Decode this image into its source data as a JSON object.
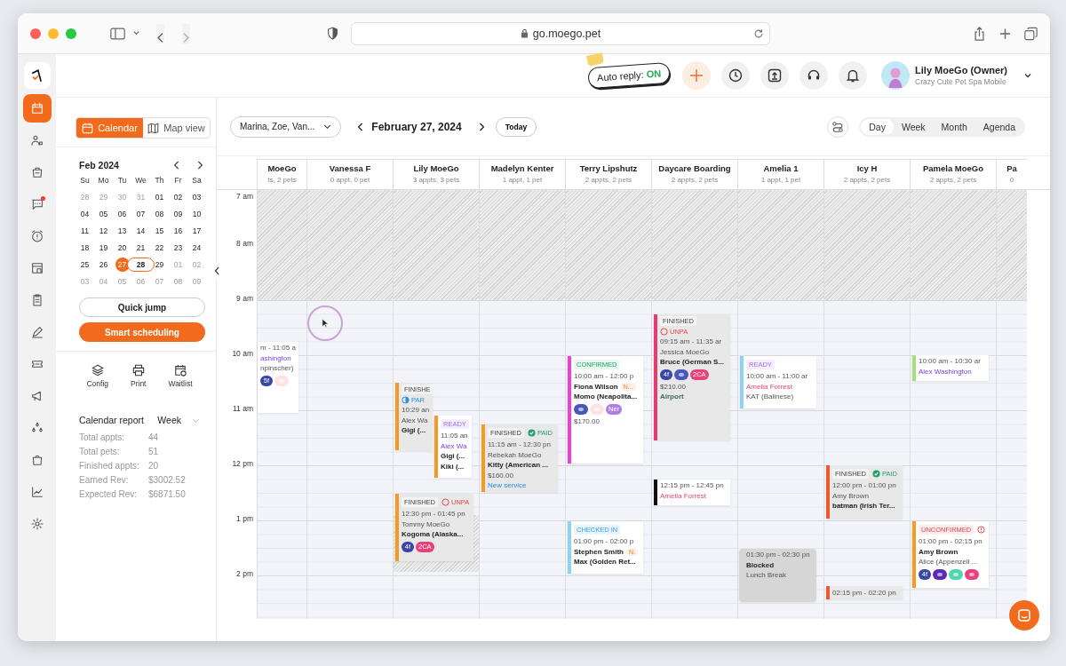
{
  "browser": {
    "url": "go.moego.pet"
  },
  "nav": [
    {
      "selected": true,
      "badge": false
    },
    {
      "selected": false,
      "badge": false
    },
    {
      "selected": false,
      "badge": false
    },
    {
      "selected": false,
      "badge": true
    },
    {
      "selected": false,
      "badge": false
    },
    {
      "selected": false,
      "badge": false
    },
    {
      "selected": false,
      "badge": false
    },
    {
      "selected": false,
      "badge": false
    },
    {
      "selected": false,
      "badge": false
    },
    {
      "selected": false,
      "badge": false
    },
    {
      "selected": false,
      "badge": false
    },
    {
      "selected": false,
      "badge": false
    },
    {
      "selected": false,
      "badge": false
    },
    {
      "selected": false,
      "badge": false
    }
  ],
  "header": {
    "auto_reply": {
      "label": "Auto reply:",
      "value": "ON"
    },
    "user": {
      "name": "Lily MoeGo (Owner)",
      "business": "Crazy Cute Pet Spa Mobile"
    }
  },
  "view_toggle": [
    {
      "label": "Calendar",
      "selected": true
    },
    {
      "label": "Map view",
      "selected": false
    }
  ],
  "mini_calendar": {
    "title": "Feb 2024",
    "weekdays": [
      "Su",
      "Mo",
      "Tu",
      "We",
      "Th",
      "Fr",
      "Sa"
    ],
    "weeks": [
      [
        {
          "day": "28",
          "muted": true,
          "selected": false,
          "today": false
        },
        {
          "day": "29",
          "muted": true,
          "selected": false,
          "today": false
        },
        {
          "day": "30",
          "muted": true,
          "selected": false,
          "today": false
        },
        {
          "day": "31",
          "muted": true,
          "selected": false,
          "today": false
        },
        {
          "day": "01",
          "muted": false,
          "selected": false,
          "today": false
        },
        {
          "day": "02",
          "muted": false,
          "selected": false,
          "today": false
        },
        {
          "day": "03",
          "muted": false,
          "selected": false,
          "today": false
        }
      ],
      [
        {
          "day": "04",
          "muted": false,
          "selected": false,
          "today": false
        },
        {
          "day": "05",
          "muted": false,
          "selected": false,
          "today": false
        },
        {
          "day": "06",
          "muted": false,
          "selected": false,
          "today": false
        },
        {
          "day": "07",
          "muted": false,
          "selected": false,
          "today": false
        },
        {
          "day": "08",
          "muted": false,
          "selected": false,
          "today": false
        },
        {
          "day": "09",
          "muted": false,
          "selected": false,
          "today": false
        },
        {
          "day": "10",
          "muted": false,
          "selected": false,
          "today": false
        }
      ],
      [
        {
          "day": "11",
          "muted": false,
          "selected": false,
          "today": false
        },
        {
          "day": "12",
          "muted": false,
          "selected": false,
          "today": false
        },
        {
          "day": "13",
          "muted": false,
          "selected": false,
          "today": false
        },
        {
          "day": "14",
          "muted": false,
          "selected": false,
          "today": false
        },
        {
          "day": "15",
          "muted": false,
          "selected": false,
          "today": false
        },
        {
          "day": "16",
          "muted": false,
          "selected": false,
          "today": false
        },
        {
          "day": "17",
          "muted": false,
          "selected": false,
          "today": false
        }
      ],
      [
        {
          "day": "18",
          "muted": false,
          "selected": false,
          "today": false
        },
        {
          "day": "19",
          "muted": false,
          "selected": false,
          "today": false
        },
        {
          "day": "20",
          "muted": false,
          "selected": false,
          "today": false
        },
        {
          "day": "21",
          "muted": false,
          "selected": false,
          "today": false
        },
        {
          "day": "22",
          "muted": false,
          "selected": false,
          "today": false
        },
        {
          "day": "23",
          "muted": false,
          "selected": false,
          "today": false
        },
        {
          "day": "24",
          "muted": false,
          "selected": false,
          "today": false
        }
      ],
      [
        {
          "day": "25",
          "muted": false,
          "selected": false,
          "today": false
        },
        {
          "day": "26",
          "muted": false,
          "selected": false,
          "today": false
        },
        {
          "day": "27",
          "muted": false,
          "selected": true,
          "today": false
        },
        {
          "day": "28",
          "muted": false,
          "selected": false,
          "today": true
        },
        {
          "day": "29",
          "muted": false,
          "selected": false,
          "today": false
        },
        {
          "day": "01",
          "muted": true,
          "selected": false,
          "today": false
        },
        {
          "day": "02",
          "muted": true,
          "selected": false,
          "today": false
        }
      ],
      [
        {
          "day": "03",
          "muted": true,
          "selected": false,
          "today": false
        },
        {
          "day": "04",
          "muted": true,
          "selected": false,
          "today": false
        },
        {
          "day": "05",
          "muted": true,
          "selected": false,
          "today": false
        },
        {
          "day": "06",
          "muted": true,
          "selected": false,
          "today": false
        },
        {
          "day": "07",
          "muted": true,
          "selected": false,
          "today": false
        },
        {
          "day": "08",
          "muted": true,
          "selected": false,
          "today": false
        },
        {
          "day": "09",
          "muted": true,
          "selected": false,
          "today": false
        }
      ]
    ]
  },
  "quick_jump": "Quick jump",
  "smart_scheduling": "Smart scheduling",
  "tools": [
    {
      "label": "Config"
    },
    {
      "label": "Print"
    },
    {
      "label": "Waitlist"
    }
  ],
  "report": {
    "title": "Calendar report",
    "period": "Week",
    "stats": [
      {
        "label": "Total appts:",
        "value": "44"
      },
      {
        "label": "Total pets:",
        "value": "51"
      },
      {
        "label": "Finished appts:",
        "value": "20"
      },
      {
        "label": "Earned Rev:",
        "value": "$3002.52"
      },
      {
        "label": "Expected Rev:",
        "value": "$6871.50"
      }
    ]
  },
  "toolbar": {
    "staff": "Marina, Zoe, Van...",
    "date": "February 27, 2024",
    "today": "Today",
    "views": [
      {
        "label": "Day",
        "selected": true
      },
      {
        "label": "Week",
        "selected": false
      },
      {
        "label": "Month",
        "selected": false
      },
      {
        "label": "Agenda",
        "selected": false
      }
    ]
  },
  "time_labels": [
    "7 am",
    "8 am",
    "9 am",
    "10 am",
    "11 am",
    "12 pm",
    "1 pm",
    "2 pm"
  ],
  "columns": [
    {
      "name": "MoeGo",
      "count": "ts, 2 pets",
      "appointments": [
        {
          "shaded": false,
          "lines": [
            {
              "kind": "time",
              "text": "m - 11:05 a"
            },
            {
              "kind": "client",
              "text": "ashington"
            },
            {
              "kind": "plain",
              "text": "npinscher)"
            }
          ],
          "tags": [
            {
              "label": "5f",
              "color": "#3a46a5"
            },
            {
              "color": "#fde2e2"
            }
          ]
        }
      ]
    },
    {
      "name": "Vanessa F",
      "count": "0 appt, 0 pet"
    },
    {
      "name": "Lily MoeGo",
      "count": "3 appts, 3 pets",
      "appointments": [
        {
          "color": "#f59a23",
          "shaded": true,
          "status": {
            "label": "FINISHE",
            "kind": "finished"
          },
          "payment": {
            "label": "PAR",
            "kind": "partial"
          },
          "lines": [
            {
              "kind": "time",
              "text": "10:29 an"
            },
            {
              "kind": "owner",
              "text": "Alex Wa"
            },
            {
              "kind": "pet",
              "text": "Gigi (..."
            }
          ]
        },
        {
          "color": "#f59a23",
          "shaded": false,
          "status": {
            "label": "READY",
            "kind": "ready"
          },
          "lines": [
            {
              "kind": "time",
              "text": "11:05 an"
            },
            {
              "kind": "client",
              "text": "Alex Wa"
            },
            {
              "kind": "pet",
              "text": "Gigi (..."
            },
            {
              "kind": "pet",
              "text": "Kiki (..."
            }
          ]
        },
        {
          "color": "#f59a23",
          "shaded": true,
          "status": {
            "label": "FINISHED",
            "kind": "finished"
          },
          "payment": {
            "label": "UNPA",
            "kind": "unpaid"
          },
          "lines": [
            {
              "kind": "time",
              "text": "12:30 pm - 01:45 pn"
            },
            {
              "kind": "owner",
              "text": "Tommy MoeGo"
            },
            {
              "kind": "pet",
              "text": "Kogoma (Alaska..."
            }
          ],
          "tags": [
            {
              "label": "4f",
              "color": "#3a46a5"
            },
            {
              "label": "2CA",
              "color": "#e8407a"
            }
          ]
        }
      ]
    },
    {
      "name": "Madelyn Kenter",
      "count": "1 appt, 1 pet",
      "appointments": [
        {
          "color": "#f59a23",
          "shaded": true,
          "status": {
            "label": "FINISHED",
            "kind": "finished"
          },
          "payment": {
            "label": "PAID",
            "kind": "paid"
          },
          "lines": [
            {
              "kind": "time",
              "text": "11:15 am - 12:30 pn"
            },
            {
              "kind": "owner",
              "text": "Rebekah MoeGo"
            },
            {
              "kind": "pet",
              "text": "Kitty (American ..."
            },
            {
              "kind": "price",
              "text": "$160.00"
            },
            {
              "kind": "link",
              "text": "New service"
            }
          ]
        }
      ]
    },
    {
      "name": "Terry Lipshutz",
      "count": "2 appts, 2 pets",
      "appointments": [
        {
          "color": "#ee3fd8",
          "shaded": false,
          "status": {
            "label": "CONFIRMED",
            "kind": "confirmed"
          },
          "lines": [
            {
              "kind": "time",
              "text": "10:00 am - 12:00 p"
            },
            {
              "kind": "name",
              "text": "Fiona Wilson",
              "badge": "N..."
            },
            {
              "kind": "pet",
              "text": "Momo (Neapolita..."
            }
          ],
          "tags": [
            {
              "color": "#4a56b8"
            },
            {
              "color": "#fde2e2"
            },
            {
              "label": "Ner",
              "color": "#b07ce8"
            }
          ],
          "after": [
            {
              "kind": "price",
              "text": "$170.00"
            }
          ]
        },
        {
          "color": "#8fd3f4",
          "shaded": false,
          "status": {
            "label": "CHECKED IN",
            "kind": "checked-in"
          },
          "lines": [
            {
              "kind": "time",
              "text": "01:00 pm - 02:00 p"
            },
            {
              "kind": "name",
              "text": "Stephen Smith",
              "badge": "N."
            },
            {
              "kind": "pet",
              "text": "Max (Golden Ret..."
            }
          ]
        }
      ]
    },
    {
      "name": "Daycare Boarding",
      "count": "2 appts, 2 pets",
      "appointments": [
        {
          "color": "#e23d73",
          "shaded": true,
          "status": {
            "label": "FINISHED",
            "kind": "finished"
          },
          "payment": {
            "label": "UNPA",
            "kind": "unpaid"
          },
          "lines": [
            {
              "kind": "time",
              "text": "09:15 am - 11:35 ar"
            },
            {
              "kind": "owner",
              "text": "Jessica MoeGo"
            },
            {
              "kind": "pet",
              "text": "Bruce (German S..."
            }
          ],
          "tags": [
            {
              "label": "4f",
              "color": "#3a46a5"
            },
            {
              "color": "#4a56b8"
            },
            {
              "label": "2CA",
              "color": "#e8407a"
            }
          ],
          "after": [
            {
              "kind": "price",
              "text": "$210.00"
            },
            {
              "kind": "note",
              "text": "Airport"
            }
          ]
        },
        {
          "color": "#111111",
          "shaded": false,
          "lines": [
            {
              "kind": "time",
              "text": "12:15 pm - 12:45 pn"
            },
            {
              "kind": "alert-client",
              "text": "Amelia Forrest"
            }
          ]
        }
      ]
    },
    {
      "name": "Amelia 1",
      "count": "1 appt, 1 pet",
      "appointments": [
        {
          "color": "#8fd3f4",
          "shaded": false,
          "status": {
            "label": "READY",
            "kind": "ready"
          },
          "lines": [
            {
              "kind": "time",
              "text": "10:00 am - 11:00 ar"
            },
            {
              "kind": "alert-client",
              "text": "Amelia Forrest"
            },
            {
              "kind": "plain",
              "text": "KAT (Balinese)"
            }
          ]
        },
        {
          "shaded": true,
          "blocked": true,
          "lines": [
            {
              "kind": "time",
              "text": "01:30 pm - 02:30 pn"
            },
            {
              "kind": "name",
              "text": "Blocked"
            },
            {
              "kind": "plain",
              "text": "Lunch Break"
            }
          ]
        }
      ]
    },
    {
      "name": "Icy H",
      "count": "2 appts, 2 pets",
      "appointments": [
        {
          "color": "#ee5a2c",
          "shaded": true,
          "status": {
            "label": "FINISHED",
            "kind": "finished"
          },
          "payment": {
            "label": "PAID",
            "kind": "paid"
          },
          "lines": [
            {
              "kind": "time",
              "text": "12:00 pm - 01:00 pn"
            },
            {
              "kind": "owner",
              "text": "Amy Brown"
            },
            {
              "kind": "pet",
              "text": "batman (Irish Ter..."
            }
          ]
        },
        {
          "color": "#ee5a2c",
          "shaded": true,
          "lines": [
            {
              "kind": "time",
              "text": "02:15 pm - 02:20 pn"
            }
          ]
        }
      ]
    },
    {
      "name": "Pamela MoeGo",
      "count": "2 appts, 2 pets",
      "appointments": [
        {
          "color": "#a6e07a",
          "shaded": false,
          "lines": [
            {
              "kind": "time",
              "text": "10:00 am - 10:30 ar"
            },
            {
              "kind": "client",
              "text": "Alex Washington"
            }
          ]
        },
        {
          "color": "#f59a23",
          "shaded": false,
          "status": {
            "label": "UNCONFIRMED",
            "kind": "unconfirmed"
          },
          "payment": {
            "kind": "alert"
          },
          "lines": [
            {
              "kind": "time",
              "text": "01:00 pm - 02:15 pn"
            },
            {
              "kind": "name",
              "text": "Amy Brown"
            },
            {
              "kind": "plain",
              "text": "Alice (Appenzell ..."
            }
          ],
          "tags": [
            {
              "label": "4f",
              "color": "#3a46a5"
            },
            {
              "color": "#5b2bb5"
            },
            {
              "color": "#4fd8b0"
            },
            {
              "color": "#e8407a"
            }
          ]
        }
      ]
    },
    {
      "name": "Pa",
      "count": "0"
    }
  ]
}
